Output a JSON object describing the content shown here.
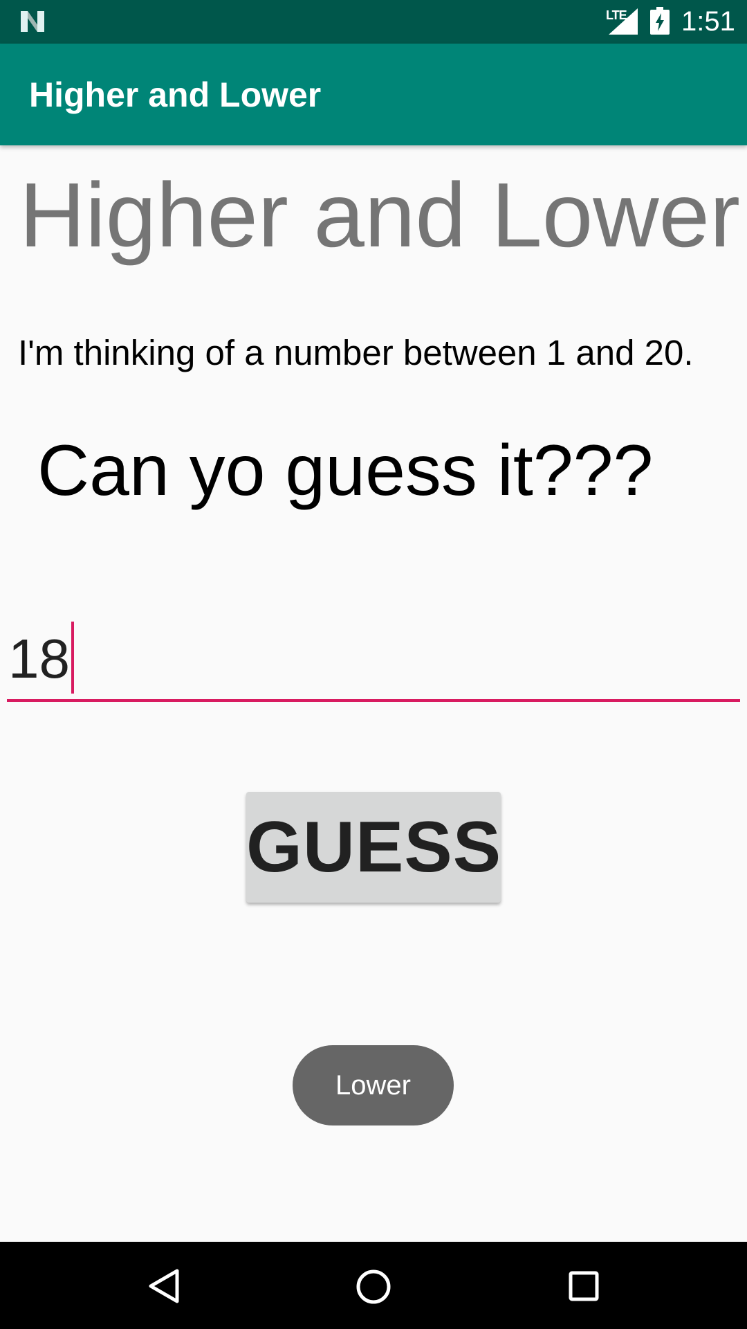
{
  "status_bar": {
    "network_label": "LTE",
    "time": "1:51",
    "icons": [
      "n-logo-icon",
      "signal-icon",
      "battery-charging-icon"
    ]
  },
  "app_bar": {
    "title": "Higher and Lower"
  },
  "main": {
    "heading": "Higher and Lower",
    "subtitle": "I'm thinking of a number between 1 and 20.",
    "prompt": "Can yo guess it???",
    "guess_input": {
      "value": "18",
      "placeholder": ""
    },
    "guess_button_label": "GUESS"
  },
  "toast": {
    "message": "Lower"
  },
  "nav_bar": {
    "icons": [
      "back-icon",
      "home-icon",
      "recents-icon"
    ]
  },
  "colors": {
    "status_bar": "#00574b",
    "app_bar": "#008577",
    "accent": "#d81b60",
    "background": "#fafafa",
    "heading_text": "#757575",
    "button_bg": "#d6d7d7",
    "toast_bg": "#666666"
  }
}
